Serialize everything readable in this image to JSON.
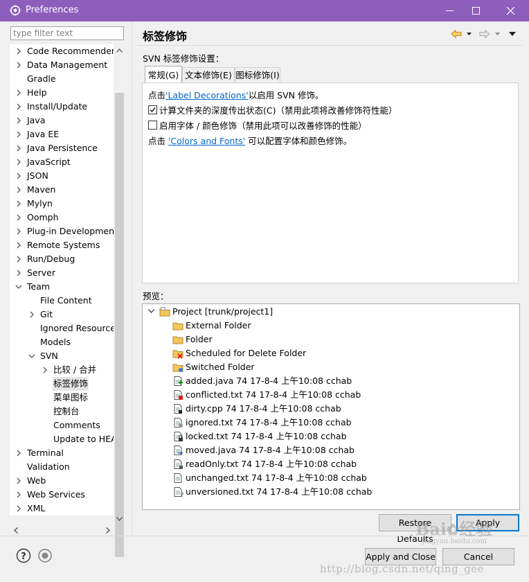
{
  "window": {
    "title": "Preferences"
  },
  "filter": {
    "placeholder": "type filter text"
  },
  "tree": {
    "items": [
      {
        "label": "Code Recommenders",
        "arrow": "right",
        "level": 0
      },
      {
        "label": "Data Management",
        "arrow": "right",
        "level": 0
      },
      {
        "label": "Gradle",
        "arrow": "none",
        "level": 0
      },
      {
        "label": "Help",
        "arrow": "right",
        "level": 0
      },
      {
        "label": "Install/Update",
        "arrow": "right",
        "level": 0
      },
      {
        "label": "Java",
        "arrow": "right",
        "level": 0
      },
      {
        "label": "Java EE",
        "arrow": "right",
        "level": 0
      },
      {
        "label": "Java Persistence",
        "arrow": "right",
        "level": 0
      },
      {
        "label": "JavaScript",
        "arrow": "right",
        "level": 0
      },
      {
        "label": "JSON",
        "arrow": "right",
        "level": 0
      },
      {
        "label": "Maven",
        "arrow": "right",
        "level": 0
      },
      {
        "label": "Mylyn",
        "arrow": "right",
        "level": 0
      },
      {
        "label": "Oomph",
        "arrow": "right",
        "level": 0
      },
      {
        "label": "Plug-in Development",
        "arrow": "right",
        "level": 0
      },
      {
        "label": "Remote Systems",
        "arrow": "right",
        "level": 0
      },
      {
        "label": "Run/Debug",
        "arrow": "right",
        "level": 0
      },
      {
        "label": "Server",
        "arrow": "right",
        "level": 0
      },
      {
        "label": "Team",
        "arrow": "down",
        "level": 0
      },
      {
        "label": "File Content",
        "arrow": "none",
        "level": 1
      },
      {
        "label": "Git",
        "arrow": "right",
        "level": 1
      },
      {
        "label": "Ignored Resource",
        "arrow": "none",
        "level": 1
      },
      {
        "label": "Models",
        "arrow": "none",
        "level": 1
      },
      {
        "label": "SVN",
        "arrow": "down",
        "level": 1
      },
      {
        "label": "比较 / 合并",
        "arrow": "right",
        "level": 2
      },
      {
        "label": "标签修饰",
        "arrow": "none",
        "level": 2,
        "selected": true
      },
      {
        "label": "菜单图标",
        "arrow": "none",
        "level": 2
      },
      {
        "label": "控制台",
        "arrow": "none",
        "level": 2
      },
      {
        "label": "Comments",
        "arrow": "none",
        "level": 2
      },
      {
        "label": "Update to HEA",
        "arrow": "none",
        "level": 2
      },
      {
        "label": "Terminal",
        "arrow": "right",
        "level": 0
      },
      {
        "label": "Validation",
        "arrow": "none",
        "level": 0
      },
      {
        "label": "Web",
        "arrow": "right",
        "level": 0
      },
      {
        "label": "Web Services",
        "arrow": "right",
        "level": 0
      },
      {
        "label": "XML",
        "arrow": "right",
        "level": 0
      }
    ]
  },
  "page": {
    "title": "标签修饰",
    "section_label": "SVN 标签修饰设置：",
    "tabs": [
      {
        "label": "常规(G)",
        "active": true
      },
      {
        "label": "文本修饰(E)",
        "active": false
      },
      {
        "label": "图标修饰(I)",
        "active": false
      }
    ],
    "general": {
      "line1_prefix": "点击",
      "line1_link": "'Label Decorations'",
      "line1_suffix": "以启用 SVN 修饰。",
      "check1_label": "计算文件夹的深度传出状态(C)（禁用此项将改善修饰符性能）",
      "check1_checked": true,
      "check2_label": "启用字体 / 颜色修饰（禁用此项可以改善修饰的性能）",
      "check2_checked": false,
      "line4_prefix": "点击 ",
      "line4_link": "'Colors and Fonts'",
      "line4_suffix": " 可以配置字体和颜色修饰。"
    },
    "preview_label": "预览：",
    "preview": {
      "project": "Project [trunk/project1]",
      "items": [
        {
          "label": "External Folder",
          "icon": "folder-icon"
        },
        {
          "label": "Folder",
          "icon": "folder-icon"
        },
        {
          "label": "Scheduled for Delete Folder",
          "icon": "folder-delete-icon"
        },
        {
          "label": "Switched Folder",
          "icon": "folder-switched-icon"
        },
        {
          "label": "added.java 74  17-8-4 上午10:08  cchab",
          "icon": "file-added-icon"
        },
        {
          "label": "conflicted.txt 74  17-8-4 上午10:08  cchab",
          "icon": "file-conflict-icon"
        },
        {
          "label": "dirty.cpp 74  17-8-4 上午10:08  cchab",
          "icon": "file-dirty-icon"
        },
        {
          "label": "ignored.txt 74  17-8-4 上午10:08  cchab",
          "icon": "file-ignored-icon"
        },
        {
          "label": "locked.txt 74  17-8-4 上午10:08  cchab",
          "icon": "file-locked-icon"
        },
        {
          "label": "moved.java 74  17-8-4 上午10:08  cchab",
          "icon": "file-moved-icon"
        },
        {
          "label": "readOnly.txt 74  17-8-4 上午10:08  cchab",
          "icon": "file-readonly-icon"
        },
        {
          "label": "unchanged.txt 74  17-8-4 上午10:08  cchab",
          "icon": "file-icon"
        },
        {
          "label": "unversioned.txt 74  17-8-4 上午10:08  cchab",
          "icon": "file-unversioned-icon"
        }
      ]
    }
  },
  "buttons": {
    "restore_defaults": "Restore Defaults",
    "apply": "Apply",
    "apply_and_close": "Apply and Close",
    "cancel": "Cancel"
  },
  "watermark": {
    "brand": "Bai",
    "brand_cn": "经验",
    "url": "http://blog.csdn.net/qing_gee",
    "sub": "jingyan.baidu.com"
  },
  "colors": {
    "titlebar": "#8e5ebd",
    "link": "#0066cc",
    "primary_border": "#0078d7"
  }
}
